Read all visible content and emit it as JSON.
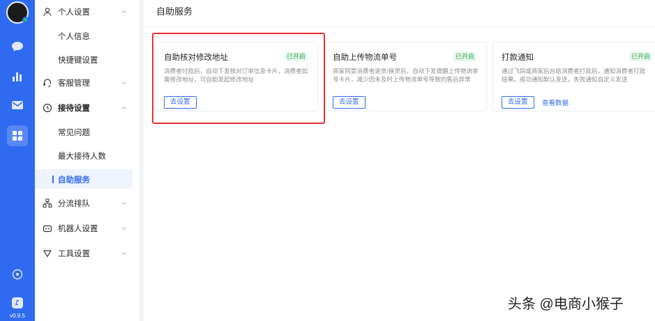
{
  "colors": {
    "accent": "#2f6bf0",
    "highlight": "#e8302f",
    "badge_green": "#35a852",
    "online": "#38c46e"
  },
  "rail": {
    "icons": [
      "chat-icon",
      "stats-icon",
      "mail-icon",
      "apps-icon",
      "settings-circle-icon",
      "app-logo-icon"
    ],
    "active_icon": "apps-icon",
    "version": "v0.9.5"
  },
  "sidebar": {
    "personal_settings": {
      "label": "个人设置",
      "icon": "user-icon",
      "expanded": true
    },
    "personal_info": "个人信息",
    "shortcut_settings": "快捷键设置",
    "service_management": {
      "label": "客服管理",
      "icon": "headset-icon",
      "expanded": false
    },
    "reception_settings": {
      "label": "接待设置",
      "icon": "clock-icon",
      "expanded": true
    },
    "faq": "常见问题",
    "max_reception": "最大接待人数",
    "self_service": "自助服务",
    "routing_queue": {
      "label": "分流排队",
      "icon": "org-icon",
      "expanded": false
    },
    "robot_settings": {
      "label": "机器人设置",
      "icon": "robot-icon",
      "expanded": false
    },
    "tool_settings": {
      "label": "工具设置",
      "icon": "tool-icon",
      "expanded": false
    }
  },
  "main": {
    "title": "自助服务",
    "cards": [
      {
        "title": "自助核对修改地址",
        "status": "已开启",
        "description": "消费者付款后，自动下发核对订单信息卡片，消费者如需修改地址，可自助发起修改地址",
        "button": "去设置"
      },
      {
        "title": "自助上传物流单号",
        "status": "已开启",
        "description": "商家同意消费者退货/换货后，自动下发提醒上传物流单号卡片，减少因未及时上传物流单号导致的售后异常",
        "button": "去设置"
      },
      {
        "title": "打款通知",
        "status": "已开启",
        "description": "通过飞鸽或商家后台给消费者打款后，通知消费者打款结果。成功通知默认发送，失败通知自定义发送",
        "button": "去设置",
        "link": "查看数据"
      }
    ]
  },
  "watermark": "头条 @电商小猴子"
}
